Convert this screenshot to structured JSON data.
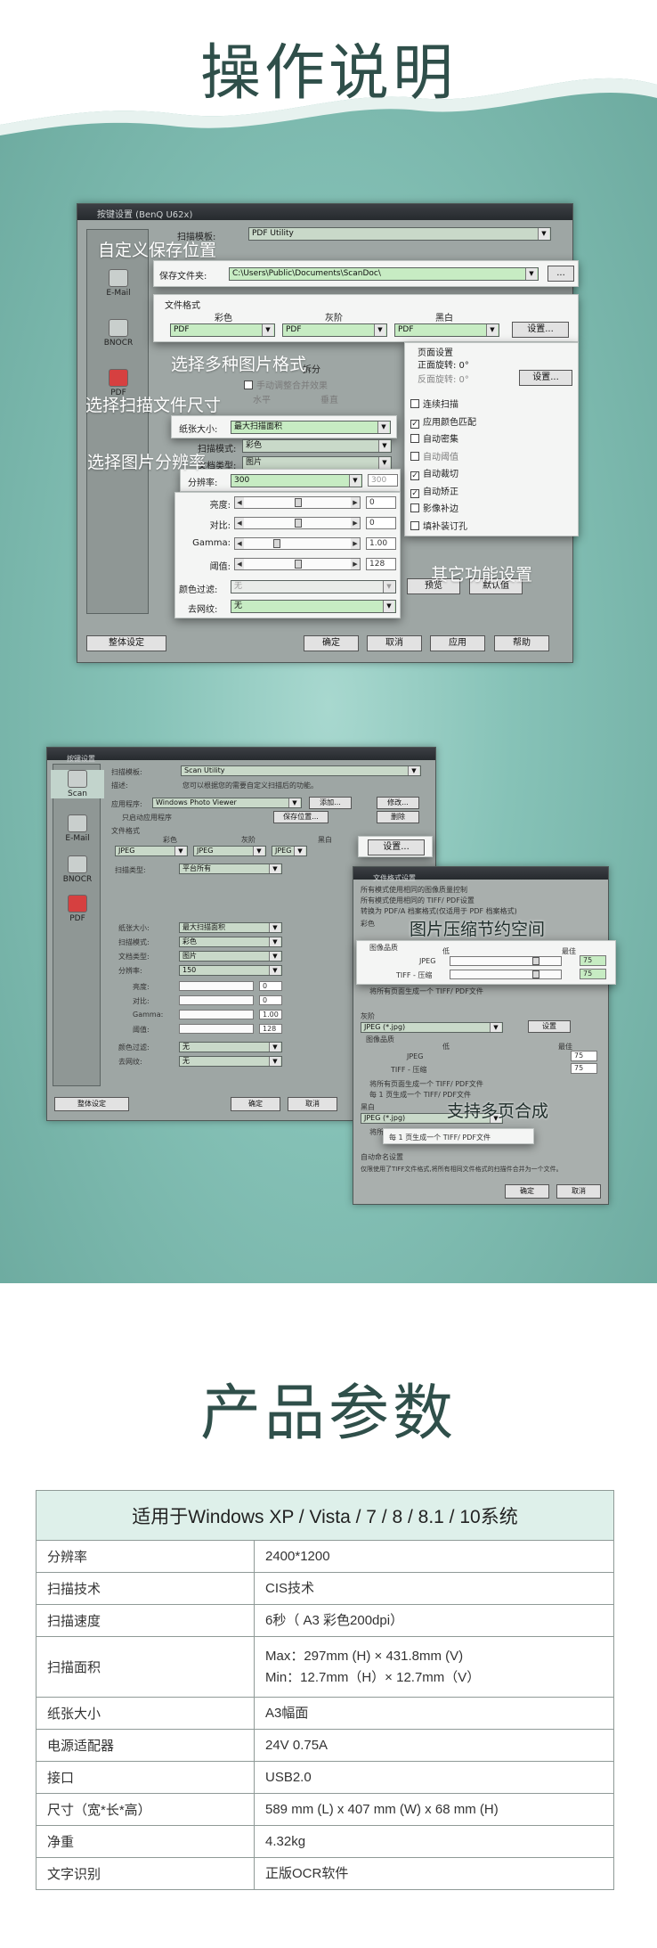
{
  "header": {
    "title": "操作说明"
  },
  "screenshot1": {
    "window_title": "按键设置 (BenQ U62x)",
    "sidebar": [
      "E-Mail",
      "BNOCR",
      "PDF"
    ],
    "scan_mode_label": "扫描模板:",
    "scan_mode_value": "PDF Utility",
    "save_folder_label": "保存文件夹:",
    "save_folder_value": "C:\\Users\\Public\\Documents\\ScanDoc\\",
    "browse_label": "...",
    "file_format_label": "文件格式",
    "format_cols": [
      "彩色",
      "灰阶",
      "黑白"
    ],
    "format_values": [
      "PDF",
      "PDF",
      "PDF"
    ],
    "settings_label": "设置...",
    "page_settings": {
      "title": "页面设置",
      "front": "正面旋转: 0°",
      "back": "反面旋转: 0°",
      "button": "设置..."
    },
    "split_label": "拆分",
    "auto_merge_label": "手动调整合并效果",
    "horizontal_label": "水平",
    "vertical_label": "垂直",
    "paper_size_label": "纸张大小:",
    "paper_size_value": "最大扫描面积",
    "scan_mode2_label": "扫描模式:",
    "scan_mode2_value": "彩色",
    "doc_type_label": "文档类型:",
    "doc_type_value": "图片",
    "resolution_label": "分辨率:",
    "resolution_value": "300",
    "resolution_right": "300",
    "adjust": [
      {
        "label": "亮度:",
        "value": "0"
      },
      {
        "label": "对比:",
        "value": "0"
      },
      {
        "label": "Gamma:",
        "value": "1.00"
      },
      {
        "label": "阈值:",
        "value": "128"
      }
    ],
    "color_filter_label": "颜色过滤:",
    "color_filter_value": "无",
    "descreen_label": "去网纹:",
    "descreen_value": "无",
    "options": [
      {
        "label": "连续扫描",
        "checked": false,
        "dim": false
      },
      {
        "label": "应用颜色匹配",
        "checked": true,
        "dim": false
      },
      {
        "label": "自动密集",
        "checked": false,
        "dim": false
      },
      {
        "label": "自动阈值",
        "checked": false,
        "dim": true
      },
      {
        "label": "自动裁切",
        "checked": true,
        "dim": false
      },
      {
        "label": "自动矫正",
        "checked": true,
        "dim": false
      },
      {
        "label": "影像补边",
        "checked": false,
        "dim": false
      },
      {
        "label": "填补装订孔",
        "checked": false,
        "dim": false
      }
    ],
    "preview_label": "预览",
    "default_label": "默认值",
    "bottom_buttons": [
      "整体设定",
      "确定",
      "取消",
      "应用",
      "帮助"
    ]
  },
  "callouts1": {
    "save_location": "自定义保存位置",
    "formats": "选择多种图片格式",
    "paper": "选择扫描文件尺寸",
    "resolution": "选择图片分辨率",
    "others": "其它功能设置"
  },
  "screenshot2": {
    "window_title": "按键设置",
    "sidebar": [
      "Scan",
      "E-Mail",
      "BNOCR",
      "PDF"
    ],
    "scan_mode_label": "扫描模板:",
    "scan_mode_value": "Scan Utility",
    "desc_label": "描述:",
    "desc_value": "您可以根据您的需要自定义扫描后的功能。",
    "app_label": "应用程序:",
    "app_value": "Windows Photo Viewer",
    "add_label": "添加...",
    "modify_label": "修改...",
    "only_start_label": "只启动应用程序",
    "save_location_label": "保存位置...",
    "delete_label": "删除",
    "file_format_label": "文件格式",
    "format_cols": [
      "彩色",
      "灰阶",
      "黑白"
    ],
    "format_values": [
      "JPEG",
      "JPEG",
      "JPEG"
    ],
    "settings_label": "设置...",
    "scan_type_label": "扫描类型:",
    "scan_type_value": "平台所有",
    "paper_size_label": "纸张大小:",
    "paper_size_value": "最大扫描面积",
    "scan_mode2_label": "扫描模式:",
    "scan_mode2_value": "彩色",
    "doc_type_label": "文档类型:",
    "doc_type_value": "图片",
    "resolution_label": "分辨率:",
    "resolution_value": "150",
    "adjust": [
      {
        "label": "亮度:",
        "value": "0"
      },
      {
        "label": "对比:",
        "value": "0"
      },
      {
        "label": "Gamma:",
        "value": "1.00"
      },
      {
        "label": "阈值:",
        "value": "128"
      }
    ],
    "color_filter_label": "颜色过滤:",
    "color_filter_value": "无",
    "descreen_label": "去网纹:",
    "descreen_value": "无",
    "bottom_buttons": [
      "整体设定",
      "确定",
      "取消"
    ]
  },
  "filefmt_dialog": {
    "title": "文件格式设置",
    "opts": [
      "所有模式使用相同的图像质量控制",
      "所有模式使用相同的 TIFF/ PDF设置",
      "转换为 PDF/A 档案格式(仅适用于 PDF 档案格式)"
    ],
    "color_label": "彩色",
    "quality_label": "图像品质",
    "low_label": "低",
    "best_label": "最佳",
    "jpeg_label": "JPEG",
    "jpeg_value": "75",
    "tiff_label": "TIFF - 压缩",
    "tiff_value": "75",
    "all_pages_label": "将所有页面生成一个 TIFF/ PDF文件",
    "each_label": "每",
    "each_value": "1",
    "pages_label": "页生成一个 TIFF/ PDF文件",
    "gray_label": "灰阶",
    "gray_format": "JPEG (*.jpg)",
    "set_label": "设置",
    "bw_label": "黑白",
    "bw_format": "JPEG (*.jpg)",
    "auto_name_label": "自动命名设置",
    "bottom_note": "仅限使用了TIFF文件格式,将所有相同文件格式的扫描件合并为一个文件。",
    "ok_label": "确定",
    "cancel_label": "取消"
  },
  "callouts2": {
    "compress": "图片压缩节约空间",
    "multipage": "支持多页合成"
  },
  "params": {
    "title": "产品参数",
    "table_header": "适用于Windows XP / Vista / 7 / 8 / 8.1 / 10系统",
    "rows": [
      {
        "k": "分辨率",
        "v": [
          "2400*1200"
        ]
      },
      {
        "k": "扫描技术",
        "v": [
          "CIS技术"
        ]
      },
      {
        "k": "扫描速度",
        "v": [
          "6秒（ A3 彩色200dpi）"
        ]
      },
      {
        "k": "扫描面积",
        "v": [
          "Max：297mm (H) × 431.8mm (V)",
          "Min：12.7mm（H）× 12.7mm（V）"
        ]
      },
      {
        "k": "纸张大小",
        "v": [
          "A3幅面"
        ]
      },
      {
        "k": "电源适配器",
        "v": [
          "24V  0.75A"
        ]
      },
      {
        "k": "接口",
        "v": [
          "USB2.0"
        ]
      },
      {
        "k": "尺寸（宽*长*高）",
        "v": [
          "589 mm (L) x 407 mm (W) x 68 mm (H)"
        ]
      },
      {
        "k": "净重",
        "v": [
          "4.32kg"
        ]
      },
      {
        "k": "文字识别",
        "v": [
          "正版OCR软件"
        ]
      }
    ]
  }
}
